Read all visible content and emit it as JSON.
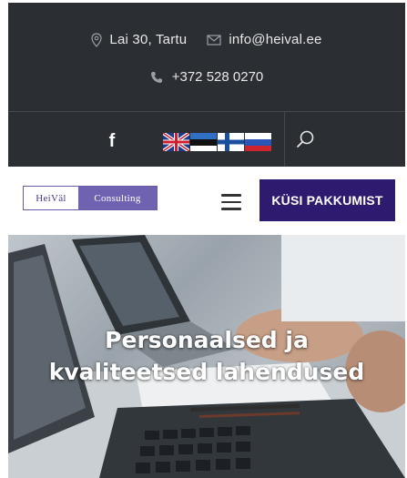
{
  "topbar": {
    "address": "Lai 30, Tartu",
    "email": "info@heival.ee",
    "phone": "+372 528 0270",
    "social": {
      "facebook_label": "f"
    },
    "languages": [
      {
        "code": "en",
        "icon": "uk-flag-icon"
      },
      {
        "code": "et",
        "icon": "estonia-flag-icon"
      },
      {
        "code": "fi",
        "icon": "finland-flag-icon"
      },
      {
        "code": "ru",
        "icon": "russia-flag-icon"
      }
    ],
    "icons": {
      "address": "location-pin-icon",
      "email": "envelope-icon",
      "phone": "phone-icon",
      "search": "search-icon"
    }
  },
  "header": {
    "logo_left": "HeiVäl",
    "logo_right": "Consulting",
    "menu_icon": "hamburger-menu-icon",
    "cta_label": "KÜSI PAKKUMIST"
  },
  "hero": {
    "title_line1": "Personaalsed ja",
    "title_line2": "kvaliteetsed lahendused"
  },
  "colors": {
    "topbar_bg": "#2b2e32",
    "cta_bg": "#2e1a6e",
    "logo_purple": "#6f62b1"
  }
}
